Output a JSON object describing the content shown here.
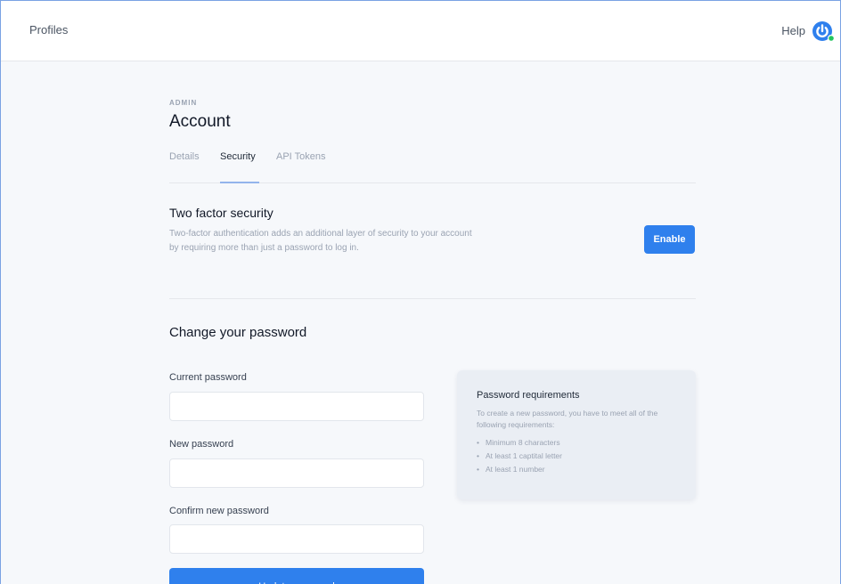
{
  "topbar": {
    "brand": "Profiles",
    "help": "Help",
    "avatar_icon": "power-logo-icon",
    "avatar_color": "#2f80ed",
    "status_color": "#22c55e"
  },
  "header": {
    "eyebrow": "ADMIN",
    "title": "Account"
  },
  "tabs": [
    {
      "label": "Details",
      "active": false
    },
    {
      "label": "Security",
      "active": true
    },
    {
      "label": "API Tokens",
      "active": false
    }
  ],
  "two_factor": {
    "title": "Two factor security",
    "description": "Two-factor authentication adds an additional layer of security to your account by requiring more than just a password to log in.",
    "button": "Enable"
  },
  "password": {
    "title": "Change your password",
    "fields": [
      {
        "label": "Current password",
        "value": ""
      },
      {
        "label": "New password",
        "value": ""
      },
      {
        "label": "Confirm new password",
        "value": ""
      }
    ],
    "button": "Update password"
  },
  "requirements": {
    "title": "Password requirements",
    "description": "To create a new password, you have to meet all of the following requirements:",
    "items": [
      "Minimum 8 characters",
      "At least 1 captital letter",
      "At least 1 number"
    ]
  },
  "colors": {
    "accent": "#2f80ed",
    "background": "#f6f8fb"
  }
}
